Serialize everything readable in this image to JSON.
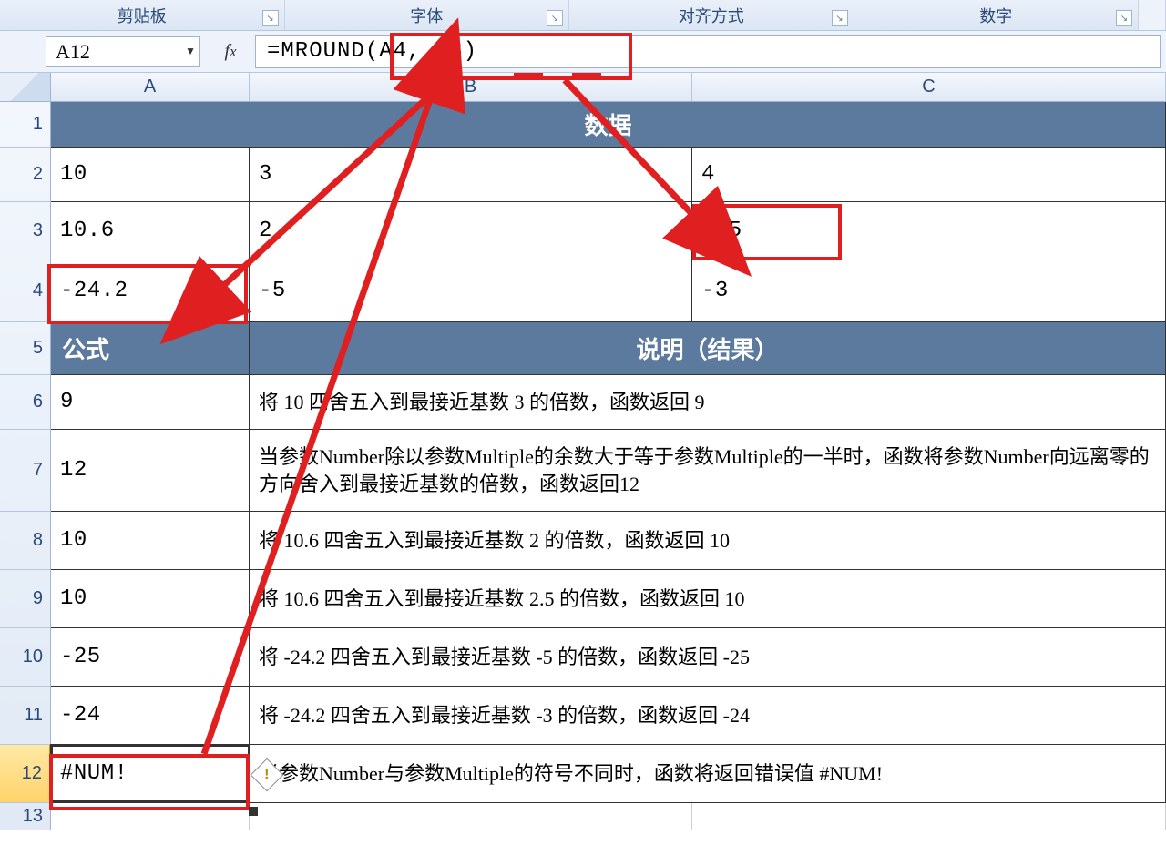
{
  "ribbon": {
    "groups": [
      "剪贴板",
      "字体",
      "对齐方式",
      "数字"
    ]
  },
  "namebox": {
    "value": "A12"
  },
  "formula": {
    "value": "=MROUND(A4, C3)"
  },
  "columns": [
    "A",
    "B",
    "C"
  ],
  "rows": [
    "1",
    "2",
    "3",
    "4",
    "5",
    "6",
    "7",
    "8",
    "9",
    "10",
    "11",
    "12",
    "13"
  ],
  "header_data": "数据",
  "header_formula": "公式",
  "header_desc": "说明（结果）",
  "t": {
    "r2a": "10",
    "r2b": "3",
    "r2c": "4",
    "r3a": "10.6",
    "r3b": "2",
    "r3c": "2.5",
    "r4a": "-24.2",
    "r4b": "-5",
    "r4c": "-3",
    "r6a": "9",
    "r6d": "将 10 四舍五入到最接近基数 3 的倍数，函数返回 9",
    "r7a": "12",
    "r7d": "当参数Number除以参数Multiple的余数大于等于参数Multiple的一半时，函数将参数Number向远离零的方向舍入到最接近基数的倍数，函数返回12",
    "r8a": "10",
    "r8d": "将 10.6 四舍五入到最接近基数 2 的倍数，函数返回 10",
    "r9a": "10",
    "r9d": "将 10.6 四舍五入到最接近基数 2.5 的倍数，函数返回 10",
    "r10a": "-25",
    "r10d": "将 -24.2 四舍五入到最接近基数 -5 的倍数，函数返回 -25",
    "r11a": "-24",
    "r11d": "将 -24.2 四舍五入到最接近基数 -3 的倍数，函数返回 -24",
    "r12a": "#NUM!",
    "r12d": "当参数Number与参数Multiple的符号不同时，函数将返回错误值 #NUM!"
  }
}
